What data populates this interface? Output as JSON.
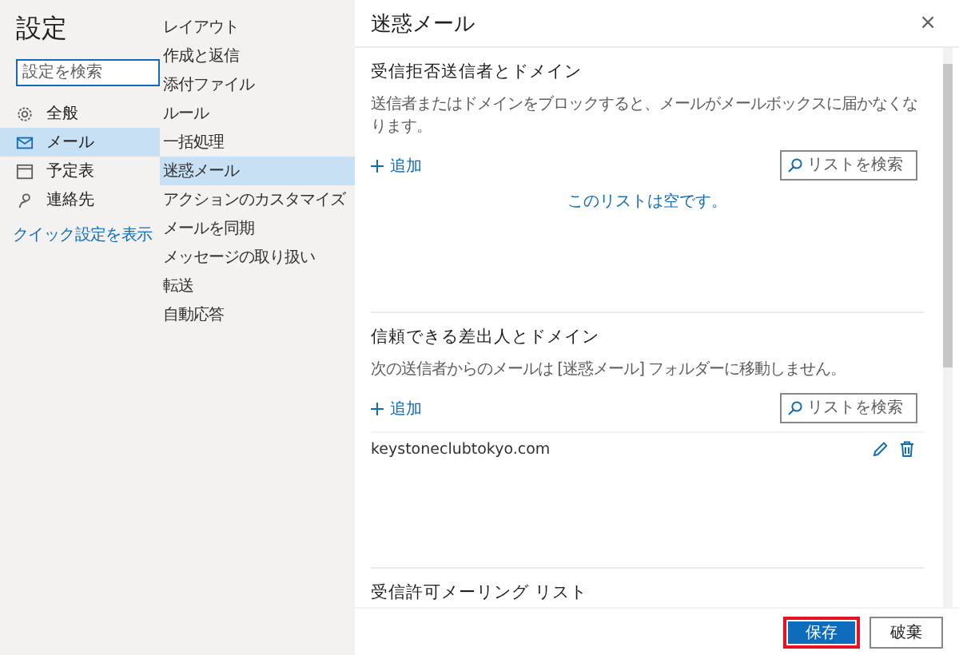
{
  "sidebar": {
    "title": "設定",
    "search": {
      "placeholder": "設定を検索"
    },
    "items": [
      {
        "label": "全般",
        "kind": "general",
        "selected": false
      },
      {
        "label": "メール",
        "kind": "mail",
        "selected": true
      },
      {
        "label": "予定表",
        "kind": "calendar",
        "selected": false
      },
      {
        "label": "連絡先",
        "kind": "contacts",
        "selected": false
      }
    ],
    "link": "クイック設定を表示"
  },
  "submenu": {
    "items": [
      {
        "label": "レイアウト",
        "selected": false
      },
      {
        "label": "作成と返信",
        "selected": false
      },
      {
        "label": "添付ファイル",
        "selected": false
      },
      {
        "label": "ルール",
        "selected": false
      },
      {
        "label": "一括処理",
        "selected": false
      },
      {
        "label": "迷惑メール",
        "selected": true
      },
      {
        "label": "アクションのカスタマイズ",
        "selected": false
      },
      {
        "label": "メールを同期",
        "selected": false
      },
      {
        "label": "メッセージの取り扱い",
        "selected": false
      },
      {
        "label": "転送",
        "selected": false
      },
      {
        "label": "自動応答",
        "selected": false
      }
    ]
  },
  "panel": {
    "title": "迷惑メール",
    "close": "×",
    "sections": [
      {
        "title": "受信拒否送信者とドメイン",
        "description": "送信者またはドメインをブロックすると、メールがメールボックスに届かなくなります。",
        "add": "追加",
        "search": {
          "placeholder": "リストを検索"
        },
        "empty_text": "このリストは空です。"
      },
      {
        "title": "信頼できる差出人とドメイン",
        "description": "次の送信者からのメールは [迷惑メール] フォルダーに移動しません。",
        "add": "追加",
        "search": {
          "placeholder": "リストを検索"
        },
        "entries": [
          "keystoneclubtokyo.com"
        ]
      },
      {
        "title": "受信許可メーリング リスト"
      }
    ]
  },
  "buttons": [
    {
      "label": "保存",
      "kind": "primary",
      "highlighted": true
    },
    {
      "label": "破棄",
      "kind": "secondary",
      "highlighted": false
    }
  ]
}
